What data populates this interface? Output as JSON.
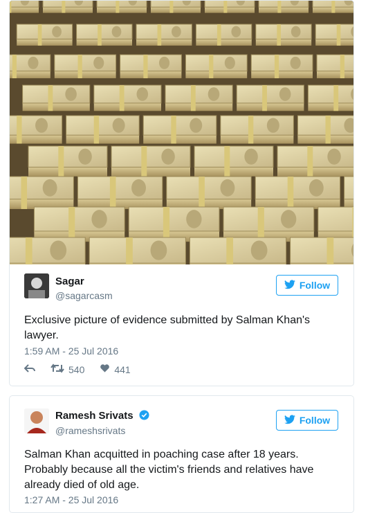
{
  "tweets": [
    {
      "name": "Sagar",
      "handle": "@sagarcasm",
      "follow_label": "Follow",
      "text": "Exclusive picture of evidence submitted by Salman Khan's lawyer.",
      "time": "1:59 AM - 25 Jul 2016",
      "retweets": "540",
      "likes": "441",
      "verified": false
    },
    {
      "name": "Ramesh Srivats",
      "handle": "@rameshsrivats",
      "follow_label": "Follow",
      "text": "Salman Khan acquitted in poaching case after 18 years. Probably because all the victim's friends and relatives have already died of old age.",
      "time": "1:27 AM - 25 Jul 2016",
      "verified": true
    }
  ],
  "colors": {
    "accent": "#1da1f2",
    "text": "#14171a",
    "muted": "#657786",
    "border": "#e1e8ed"
  },
  "icons": [
    "twitter-bird-icon",
    "reply-icon",
    "retweet-icon",
    "heart-icon",
    "verified-badge-icon"
  ]
}
